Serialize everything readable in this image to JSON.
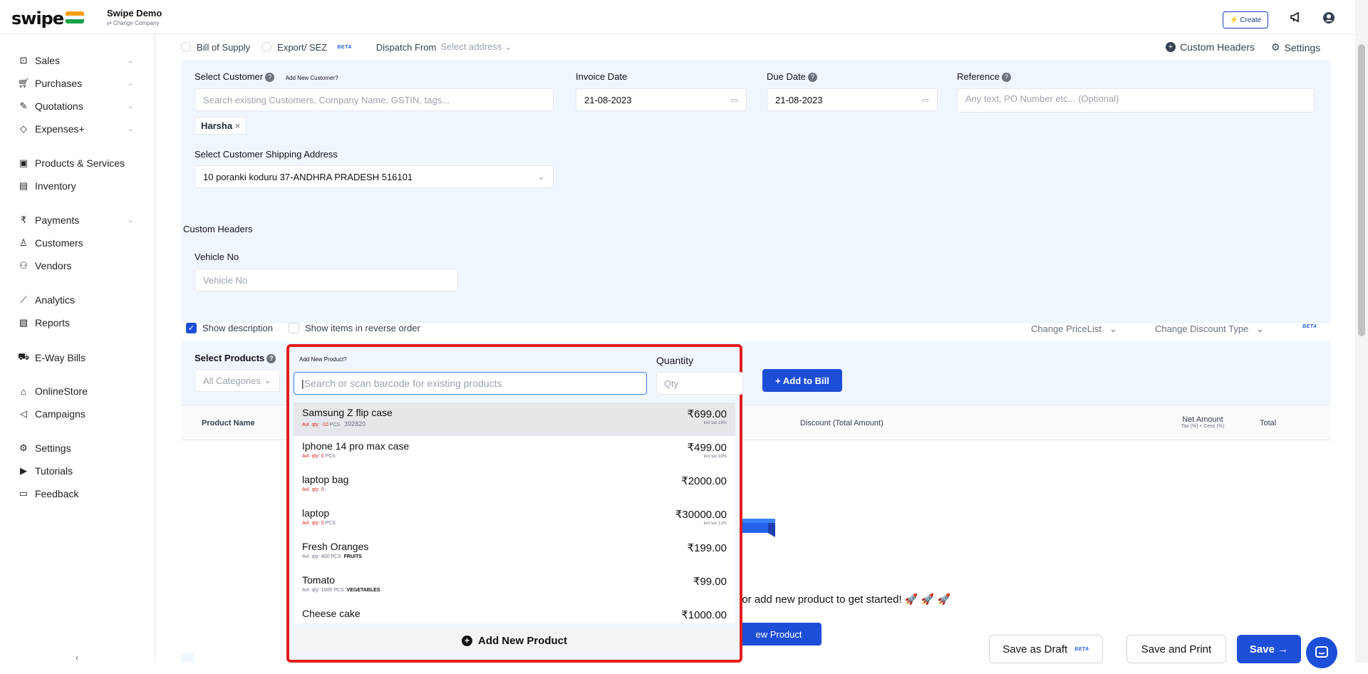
{
  "app": {
    "logo": "swipe",
    "company_name": "Swipe Demo",
    "change_company": "⇄ Change Company",
    "create_label": "Create"
  },
  "colors": {
    "primary": "#1d4ed8",
    "panel_bg": "#f0f6ff",
    "highlight_border": "#e11d1d"
  },
  "sidebar": {
    "items": [
      {
        "label": "Sales",
        "icon": "sales-icon"
      },
      {
        "label": "Purchases",
        "icon": "cart-icon"
      },
      {
        "label": "Quotations",
        "icon": "pen-icon"
      },
      {
        "label": "Expenses+",
        "icon": "tag-icon"
      },
      {
        "label": "Products & Services",
        "icon": "box-icon"
      },
      {
        "label": "Inventory",
        "icon": "warehouse-icon"
      },
      {
        "label": "Payments",
        "icon": "rupee-icon"
      },
      {
        "label": "Customers",
        "icon": "user-icon"
      },
      {
        "label": "Vendors",
        "icon": "users-icon"
      },
      {
        "label": "Analytics",
        "icon": "chart-icon"
      },
      {
        "label": "Reports",
        "icon": "report-icon"
      },
      {
        "label": "E-Way Bills",
        "icon": "truck-icon"
      },
      {
        "label": "OnlineStore",
        "icon": "store-icon"
      },
      {
        "label": "Campaigns",
        "icon": "megaphone-icon"
      },
      {
        "label": "Settings",
        "icon": "settings-icon"
      },
      {
        "label": "Tutorials",
        "icon": "video-icon"
      },
      {
        "label": "Feedback",
        "icon": "feedback-icon"
      }
    ],
    "collapse_arrow": "‹"
  },
  "options": {
    "bill_of_supply": "Bill of Supply",
    "export_sez": "Export/ SEZ",
    "beta": "BETA",
    "dispatch_from": "Dispatch From",
    "select_address": "Select address",
    "custom_headers": "Custom Headers",
    "settings": "Settings"
  },
  "customer": {
    "label": "Select Customer",
    "add_new": "Add New Customer?",
    "placeholder": "Search existing Customers, Company Name, GSTIN, tags...",
    "selected": "Harsha",
    "shipping_label": "Select Customer Shipping Address",
    "shipping_value": "10 poranki koduru 37-ANDHRA PRADESH 516101"
  },
  "invoice_date": {
    "label": "Invoice Date",
    "value": "21-08-2023"
  },
  "due_date": {
    "label": "Due Date",
    "value": "21-08-2023"
  },
  "reference": {
    "label": "Reference",
    "placeholder": "Any text, PO Number etc... (Optional)"
  },
  "custom_headers": {
    "title": "Custom Headers",
    "vehicle_label": "Vehicle No",
    "vehicle_placeholder": "Vehicle No"
  },
  "items_opts": {
    "show_description": "Show description",
    "reverse_order": "Show items in reverse order",
    "change_pricelist": "Change PriceList",
    "change_discount": "Change Discount Type",
    "beta": "BETA"
  },
  "products": {
    "label": "Select Products",
    "add_new": "Add New Product?",
    "categories": "All Categories",
    "search_placeholder": "Search or scan barcode for existing products",
    "qty_label": "Quantity",
    "qty_placeholder": "Qty",
    "add_to_bill": "+ Add to Bill"
  },
  "table": {
    "product_name": "Product Name",
    "discount": "Discount (Total Amount)",
    "net_amount": "Net Amount",
    "net_sub": "Tax (%) + Cess (%)",
    "total": "Total"
  },
  "empty": {
    "message": "t or add new product to get started! 🚀 🚀 🚀",
    "button": "ew Product"
  },
  "dropdown": {
    "items": [
      {
        "name": "Samsung Z flip case",
        "price": "₹699.00",
        "qty": "Avl. qty: -10",
        "unit": "PCS",
        "extra": "392820",
        "tax": "incl tax 18%"
      },
      {
        "name": "Iphone 14 pro max case",
        "price": "₹499.00",
        "qty": "Avl. qty: 0",
        "unit": "PCS",
        "extra": "",
        "tax": "incl tax 18%"
      },
      {
        "name": "laptop bag",
        "price": "₹2000.00",
        "qty": "Avl. qty: 0",
        "unit": "",
        "extra": "",
        "tax": ""
      },
      {
        "name": "laptop",
        "price": "₹30000.00",
        "qty": "Avl. qty: 0",
        "unit": "PCS",
        "extra": "",
        "tax": "incl tax 12%"
      },
      {
        "name": "Fresh Oranges",
        "price": "₹199.00",
        "qty": "Avl. qty: 400",
        "unit": "PCS",
        "extra": "FRUITS",
        "tax": ""
      },
      {
        "name": "Tomato",
        "price": "₹99.00",
        "qty": "Avl. qty: 1000",
        "unit": "PCS",
        "extra": "VEGETABLES",
        "tax": ""
      },
      {
        "name": "Cheese cake",
        "price": "₹1000.00",
        "qty": "",
        "unit": "",
        "extra": "",
        "tax": ""
      }
    ],
    "add_new_product": "Add New Product"
  },
  "footer": {
    "save_draft": "Save as Draft",
    "beta": "BETA",
    "save_print": "Save and Print",
    "save": "Save →"
  }
}
